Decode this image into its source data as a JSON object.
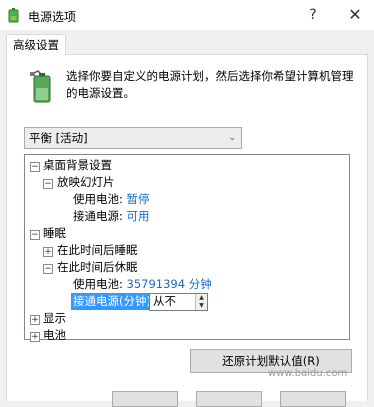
{
  "window": {
    "title": "电源选项",
    "help_glyph": "?",
    "close_glyph": "✕"
  },
  "tab": {
    "label": "高级设置"
  },
  "description": "选择你要自定义的电源计划，然后选择你希望计算机管理的电源设置。",
  "plan_select": {
    "value": "平衡 [活动]",
    "chevron": "⌄"
  },
  "tree": {
    "desktop_background": {
      "label": "桌面背景设置",
      "expander": "−"
    },
    "slideshow": {
      "label": "放映幻灯片",
      "expander": "−"
    },
    "slideshow_battery": {
      "label": "使用电池:",
      "value": "暂停"
    },
    "slideshow_ac": {
      "label": "接通电源:",
      "value": "可用"
    },
    "sleep": {
      "label": "睡眠",
      "expander": "−"
    },
    "sleep_after": {
      "label": "在此时间后睡眠",
      "expander": "+"
    },
    "hibernate_after": {
      "label": "在此时间后休眠",
      "expander": "−"
    },
    "hibernate_battery": {
      "label": "使用电池:",
      "value": "35791394 分钟"
    },
    "hibernate_ac": {
      "label": "接通电源(分钟):",
      "value": "从不"
    },
    "display": {
      "label": "显示",
      "expander": "+"
    },
    "battery": {
      "label": "电池",
      "expander": "+"
    }
  },
  "restore_button": {
    "label": "还原计划默认值(R)"
  },
  "watermark": "www.baidu.com",
  "colors": {
    "selection": "#3399ff",
    "link": "#1a6bc7",
    "window_bg": "#f0f0f0"
  },
  "icons": {
    "app": "power-options-icon",
    "battery": "battery-plug-icon"
  }
}
